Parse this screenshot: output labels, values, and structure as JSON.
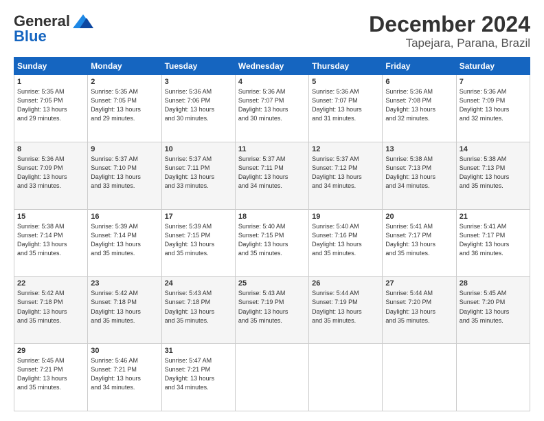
{
  "header": {
    "logo_line1": "General",
    "logo_line2": "Blue",
    "title": "December 2024",
    "subtitle": "Tapejara, Parana, Brazil"
  },
  "weekdays": [
    "Sunday",
    "Monday",
    "Tuesday",
    "Wednesday",
    "Thursday",
    "Friday",
    "Saturday"
  ],
  "weeks": [
    [
      {
        "day": "1",
        "info": "Sunrise: 5:35 AM\nSunset: 7:05 PM\nDaylight: 13 hours\nand 29 minutes."
      },
      {
        "day": "2",
        "info": "Sunrise: 5:35 AM\nSunset: 7:05 PM\nDaylight: 13 hours\nand 29 minutes."
      },
      {
        "day": "3",
        "info": "Sunrise: 5:36 AM\nSunset: 7:06 PM\nDaylight: 13 hours\nand 30 minutes."
      },
      {
        "day": "4",
        "info": "Sunrise: 5:36 AM\nSunset: 7:07 PM\nDaylight: 13 hours\nand 30 minutes."
      },
      {
        "day": "5",
        "info": "Sunrise: 5:36 AM\nSunset: 7:07 PM\nDaylight: 13 hours\nand 31 minutes."
      },
      {
        "day": "6",
        "info": "Sunrise: 5:36 AM\nSunset: 7:08 PM\nDaylight: 13 hours\nand 32 minutes."
      },
      {
        "day": "7",
        "info": "Sunrise: 5:36 AM\nSunset: 7:09 PM\nDaylight: 13 hours\nand 32 minutes."
      }
    ],
    [
      {
        "day": "8",
        "info": "Sunrise: 5:36 AM\nSunset: 7:09 PM\nDaylight: 13 hours\nand 33 minutes."
      },
      {
        "day": "9",
        "info": "Sunrise: 5:37 AM\nSunset: 7:10 PM\nDaylight: 13 hours\nand 33 minutes."
      },
      {
        "day": "10",
        "info": "Sunrise: 5:37 AM\nSunset: 7:11 PM\nDaylight: 13 hours\nand 33 minutes."
      },
      {
        "day": "11",
        "info": "Sunrise: 5:37 AM\nSunset: 7:11 PM\nDaylight: 13 hours\nand 34 minutes."
      },
      {
        "day": "12",
        "info": "Sunrise: 5:37 AM\nSunset: 7:12 PM\nDaylight: 13 hours\nand 34 minutes."
      },
      {
        "day": "13",
        "info": "Sunrise: 5:38 AM\nSunset: 7:13 PM\nDaylight: 13 hours\nand 34 minutes."
      },
      {
        "day": "14",
        "info": "Sunrise: 5:38 AM\nSunset: 7:13 PM\nDaylight: 13 hours\nand 35 minutes."
      }
    ],
    [
      {
        "day": "15",
        "info": "Sunrise: 5:38 AM\nSunset: 7:14 PM\nDaylight: 13 hours\nand 35 minutes."
      },
      {
        "day": "16",
        "info": "Sunrise: 5:39 AM\nSunset: 7:14 PM\nDaylight: 13 hours\nand 35 minutes."
      },
      {
        "day": "17",
        "info": "Sunrise: 5:39 AM\nSunset: 7:15 PM\nDaylight: 13 hours\nand 35 minutes."
      },
      {
        "day": "18",
        "info": "Sunrise: 5:40 AM\nSunset: 7:15 PM\nDaylight: 13 hours\nand 35 minutes."
      },
      {
        "day": "19",
        "info": "Sunrise: 5:40 AM\nSunset: 7:16 PM\nDaylight: 13 hours\nand 35 minutes."
      },
      {
        "day": "20",
        "info": "Sunrise: 5:41 AM\nSunset: 7:17 PM\nDaylight: 13 hours\nand 35 minutes."
      },
      {
        "day": "21",
        "info": "Sunrise: 5:41 AM\nSunset: 7:17 PM\nDaylight: 13 hours\nand 36 minutes."
      }
    ],
    [
      {
        "day": "22",
        "info": "Sunrise: 5:42 AM\nSunset: 7:18 PM\nDaylight: 13 hours\nand 35 minutes."
      },
      {
        "day": "23",
        "info": "Sunrise: 5:42 AM\nSunset: 7:18 PM\nDaylight: 13 hours\nand 35 minutes."
      },
      {
        "day": "24",
        "info": "Sunrise: 5:43 AM\nSunset: 7:18 PM\nDaylight: 13 hours\nand 35 minutes."
      },
      {
        "day": "25",
        "info": "Sunrise: 5:43 AM\nSunset: 7:19 PM\nDaylight: 13 hours\nand 35 minutes."
      },
      {
        "day": "26",
        "info": "Sunrise: 5:44 AM\nSunset: 7:19 PM\nDaylight: 13 hours\nand 35 minutes."
      },
      {
        "day": "27",
        "info": "Sunrise: 5:44 AM\nSunset: 7:20 PM\nDaylight: 13 hours\nand 35 minutes."
      },
      {
        "day": "28",
        "info": "Sunrise: 5:45 AM\nSunset: 7:20 PM\nDaylight: 13 hours\nand 35 minutes."
      }
    ],
    [
      {
        "day": "29",
        "info": "Sunrise: 5:45 AM\nSunset: 7:21 PM\nDaylight: 13 hours\nand 35 minutes."
      },
      {
        "day": "30",
        "info": "Sunrise: 5:46 AM\nSunset: 7:21 PM\nDaylight: 13 hours\nand 34 minutes."
      },
      {
        "day": "31",
        "info": "Sunrise: 5:47 AM\nSunset: 7:21 PM\nDaylight: 13 hours\nand 34 minutes."
      },
      null,
      null,
      null,
      null
    ]
  ]
}
